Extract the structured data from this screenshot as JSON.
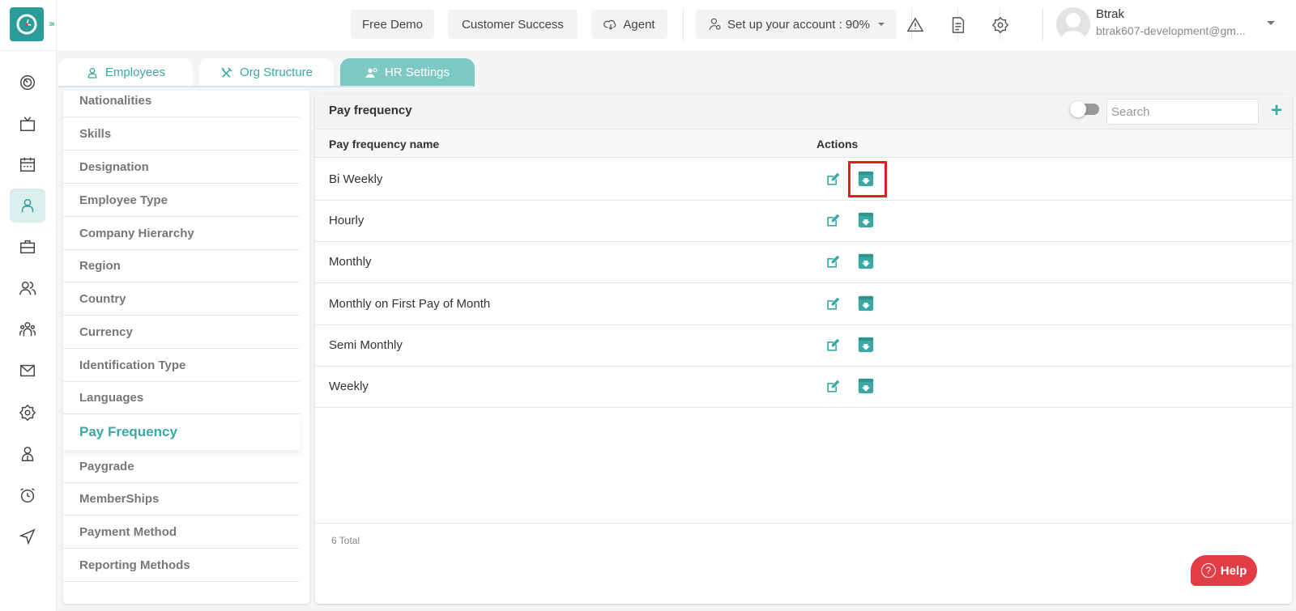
{
  "app": {
    "expand_glyph": "›››"
  },
  "topbar": {
    "free_demo": "Free Demo",
    "customer_success": "Customer Success",
    "agent": "Agent",
    "setup": "Set up your account : 90%",
    "setup_progress_percent": 90,
    "user_name": "Btrak",
    "user_email": "btrak607-development@gm..."
  },
  "rail": {
    "items": [
      {
        "icon": "dashboard-icon"
      },
      {
        "icon": "tv-icon"
      },
      {
        "icon": "calendar-icon"
      },
      {
        "icon": "user-icon",
        "active": true
      },
      {
        "icon": "briefcase-icon"
      },
      {
        "icon": "users-icon"
      },
      {
        "icon": "team-icon"
      },
      {
        "icon": "mail-icon"
      },
      {
        "icon": "gear-icon"
      },
      {
        "icon": "profile-icon"
      },
      {
        "icon": "alarm-icon"
      },
      {
        "icon": "send-icon"
      }
    ]
  },
  "tabs": [
    {
      "label": "Employees",
      "icon": "user-icon"
    },
    {
      "label": "Org Structure",
      "icon": "tools-icon"
    },
    {
      "label": "HR Settings",
      "icon": "users-settings-icon",
      "active": true
    }
  ],
  "settings_menu": {
    "items": [
      "Nationalities",
      "Skills",
      "Designation",
      "Employee Type",
      "Company Hierarchy",
      "Region",
      "Country",
      "Currency",
      "Identification Type",
      "Languages",
      "Pay Frequency",
      "Paygrade",
      "MemberShips",
      "Payment Method",
      "Reporting Methods"
    ],
    "active": "Pay Frequency"
  },
  "card": {
    "title": "Pay frequency",
    "search_placeholder": "Search",
    "add_label": "+",
    "columns": {
      "name": "Pay frequency name",
      "actions": "Actions"
    },
    "rows": [
      "Bi Weekly",
      "Hourly",
      "Monthly",
      "Monthly on First Pay of Month",
      "Semi Monthly",
      "Weekly"
    ],
    "total": "6 Total"
  },
  "help": {
    "label": "Help",
    "icon_glyph": "?"
  },
  "colors": {
    "accent": "#3aa8a3",
    "logo": "#2a9d99",
    "help": "#e23d44",
    "highlight": "#e01e1e"
  }
}
